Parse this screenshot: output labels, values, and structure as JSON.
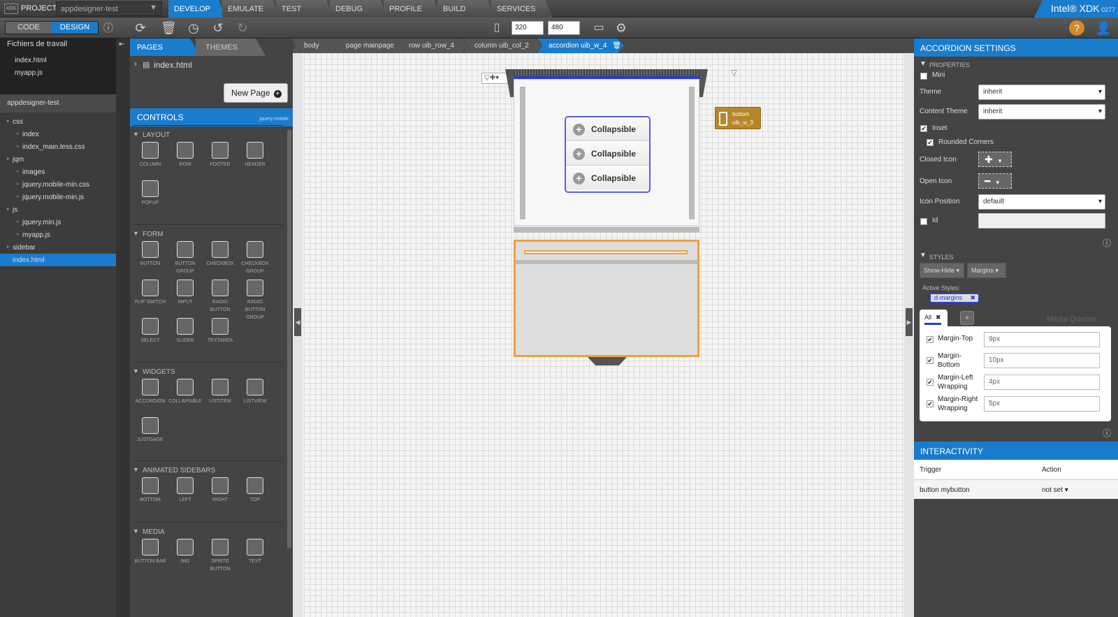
{
  "topbar": {
    "logo": "XDK",
    "projects": "PROJECTS",
    "project_name": "appdesigner-test",
    "tabs": [
      {
        "label": "DEVELOP"
      },
      {
        "label": "EMULATE"
      },
      {
        "label": "TEST"
      },
      {
        "label": "DEBUG"
      },
      {
        "label": "PROFILE"
      },
      {
        "label": "BUILD"
      },
      {
        "label": "SERVICES"
      }
    ],
    "brand": "Intel® XDK",
    "version": "0277"
  },
  "toolbar": {
    "code": "CODE",
    "design": "DESIGN",
    "width": "320",
    "height": "480"
  },
  "files": {
    "title": "Fichiers de travail",
    "open": [
      "index.html",
      "myapp.js"
    ],
    "project": "appdesigner-test",
    "tree": [
      {
        "label": "css",
        "indent": 0
      },
      {
        "label": "index",
        "indent": 1
      },
      {
        "label": "index_main.less.css",
        "indent": 1
      },
      {
        "label": "jqm",
        "indent": 0
      },
      {
        "label": "images",
        "indent": 1
      },
      {
        "label": "jquery.mobile-min.css",
        "indent": 1
      },
      {
        "label": "jquery.mobile-min.js",
        "indent": 1
      },
      {
        "label": "js",
        "indent": 0
      },
      {
        "label": "jquery.min.js",
        "indent": 1
      },
      {
        "label": "myapp.js",
        "indent": 1
      },
      {
        "label": "sidebar",
        "indent": 0
      },
      {
        "label": "index.html",
        "indent": 0
      }
    ]
  },
  "pages": {
    "tab_pages": "PAGES",
    "tab_themes": "THEMES",
    "file": "index.html",
    "new_page": "New Page"
  },
  "controls": {
    "title": "CONTROLS",
    "subtitle": "jquery mobile",
    "layout": "LAYOUT",
    "layout_items": [
      "COLUMN",
      "ROW",
      "FOOTER",
      "HEADER",
      "POPUP"
    ],
    "form": "FORM",
    "form_items": [
      "BUTTON",
      "BUTTON GROUP",
      "CHECKBOX",
      "CHECKBOX GROUP",
      "FLIP SWITCH",
      "INPUT",
      "RADIO BUTTON",
      "RADIO BUTTON GROUP",
      "SELECT",
      "SLIDER",
      "TEXTAREA"
    ],
    "widgets": "WIDGETS",
    "widget_items": [
      "ACCORDION",
      "COLLAPSIBLE",
      "LISTITEM",
      "LISTVIEW",
      "JUSTGAGE"
    ],
    "sidebars": "ANIMATED SIDEBARS",
    "sidebar_items": [
      "BOTTOM",
      "LEFT",
      "RIGHT",
      "TOP"
    ],
    "media": "MEDIA",
    "media_items": [
      "BUTTON BAR",
      "IMG",
      "SPRITE BUTTON",
      "TEXT"
    ]
  },
  "breadcrumb": [
    "body",
    "page mainpage",
    "row uib_row_4",
    "column uib_col_2",
    "accordion uib_w_4"
  ],
  "canvas": {
    "collapsibles": [
      "Collapsible",
      "Collapsible",
      "Collapsible"
    ],
    "bottom_tag": [
      "bottom",
      "uib_w_3"
    ]
  },
  "settings": {
    "title": "ACCORDION SETTINGS",
    "properties": "PROPERTIES",
    "mini": "Mini",
    "theme_label": "Theme",
    "theme_value": "inherit",
    "content_theme_label": "Content Theme",
    "content_theme_value": "inherit",
    "inset": "Inset",
    "rounded": "Rounded Corners",
    "closed_icon": "Closed Icon",
    "open_icon": "Open Icon",
    "icon_position_label": "Icon Position",
    "icon_position_value": "default",
    "id": "Id",
    "styles": "STYLES",
    "show_hide": "Show-Hide",
    "margins": "Margins",
    "active_styles": "Active Styles:",
    "tag": "d-margins",
    "all": "All",
    "media_queries": "Media Queries",
    "margin_rows": [
      {
        "label": "Margin-Top",
        "value": "9px"
      },
      {
        "label": "Margin-Bottom",
        "value": "10px"
      },
      {
        "label": "Margin-Left Wrapping",
        "value": "4px"
      },
      {
        "label": "Margin-Right Wrapping",
        "value": "5px"
      }
    ]
  },
  "interactivity": {
    "title": "INTERACTIVITY",
    "col_trigger": "Trigger",
    "col_action": "Action",
    "rows": [
      {
        "trigger": "button mybutton",
        "action": "not set"
      }
    ]
  }
}
